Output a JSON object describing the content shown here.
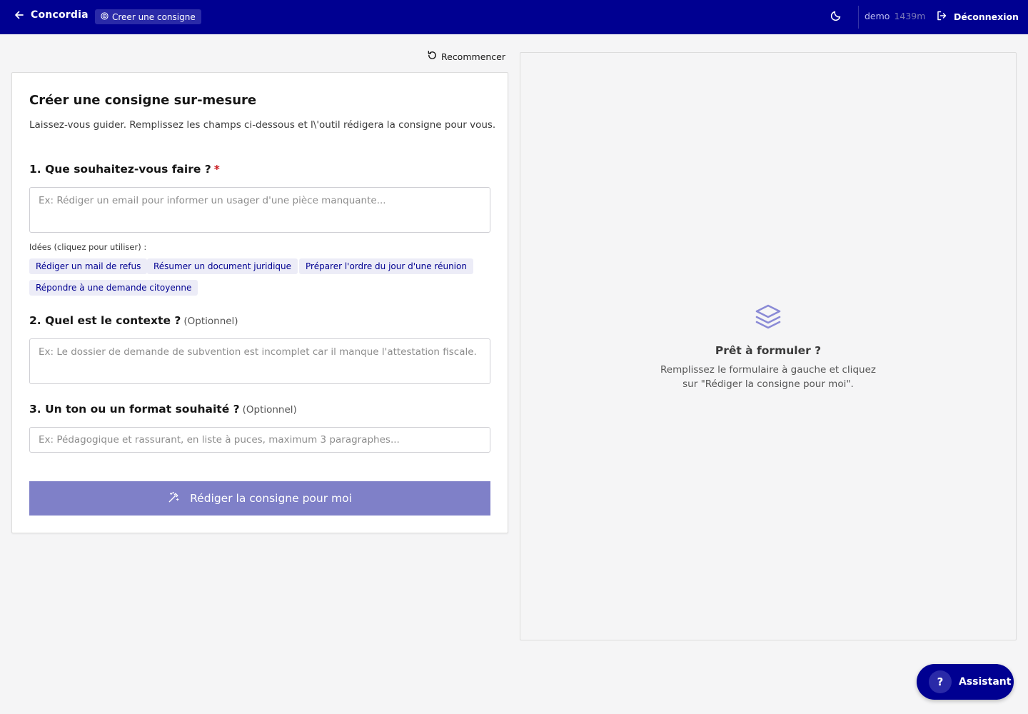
{
  "header": {
    "app_name": "Concordia",
    "page_chip": "Creer une consigne",
    "user_name": "demo",
    "session_time": "1439m",
    "logout_label": "Déconnexion"
  },
  "toolbar": {
    "reset_label": "Recommencer"
  },
  "form": {
    "title": "Créer une consigne sur-mesure",
    "subtitle": "Laissez-vous guider. Remplissez les champs ci-dessous et l\\'outil rédigera la consigne pour vous.",
    "q1": {
      "label": "1. Que souhaitez-vous faire ?",
      "required_mark": "*",
      "placeholder": "Ex: Rédiger un email pour informer un usager d'une pièce manquante..."
    },
    "ideas_label": "Idées (cliquez pour utiliser) :",
    "ideas": [
      "Rédiger un mail de refus",
      "Résumer un document juridique",
      "Préparer l'ordre du jour d'une réunion",
      "Répondre à une demande citoyenne"
    ],
    "q2": {
      "label": "2. Quel est le contexte ?",
      "optional": "(Optionnel)",
      "placeholder": "Ex: Le dossier de demande de subvention est incomplet car il manque l'attestation fiscale."
    },
    "q3": {
      "label": "3. Un ton ou un format souhaité ?",
      "optional": "(Optionnel)",
      "placeholder": "Ex: Pédagogique et rassurant, en liste à puces, maximum 3 paragraphes..."
    },
    "submit_label": "Rédiger la consigne pour moi"
  },
  "preview": {
    "icon": "stack-layers-icon",
    "title": "Prêt à formuler ?",
    "description": "Remplissez le formulaire à gauche et cliquez sur \"Rédiger la consigne pour moi\"."
  },
  "assistant": {
    "icon_glyph": "?",
    "label": "Assistant"
  },
  "colors": {
    "primary": "#000091",
    "button_disabled": "#7f80c8",
    "chip_bg": "#ececf7",
    "required": "#c9191e",
    "stack_icon": "#8a8ad6"
  }
}
